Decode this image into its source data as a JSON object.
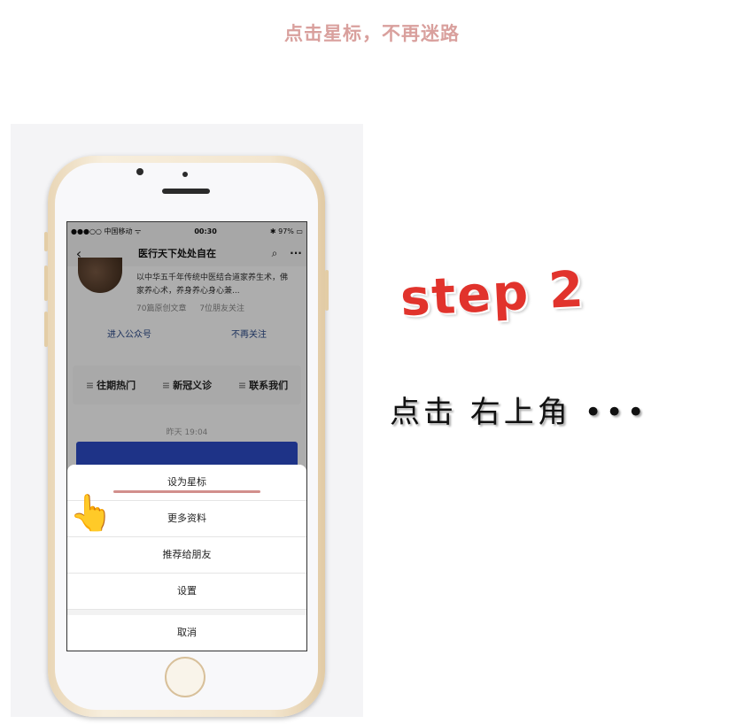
{
  "header": {
    "title": "点击星标，不再迷路"
  },
  "phone": {
    "status": {
      "carrier": "●●●○○ 中国移动 ᯤ",
      "time": "00:30",
      "battery": "✱ 97% ▭"
    },
    "nav": {
      "back": "‹",
      "title": "医行天下处处自在",
      "search": "⌕",
      "more": "···"
    },
    "profile": {
      "description": "以中华五千年传统中医结合道家养生术，佛家养心术，养身养心身心兼...",
      "articles": "70篇原创文章",
      "friends": "7位朋友关注",
      "enter": "进入公众号",
      "unfollow": "不再关注"
    },
    "menu": [
      "往期热门",
      "新冠义诊",
      "联系我们"
    ],
    "time_label": "昨天 19:04",
    "sheet": {
      "items": [
        "设为星标",
        "更多资料",
        "推荐给朋友",
        "设置"
      ],
      "cancel": "取消"
    }
  },
  "finger_icon": "👆",
  "step": {
    "title": "step 2",
    "desc": "点击 右上角 •••"
  },
  "colors": {
    "accent_pink": "#d9a09d",
    "step_red": "#e1332c"
  }
}
